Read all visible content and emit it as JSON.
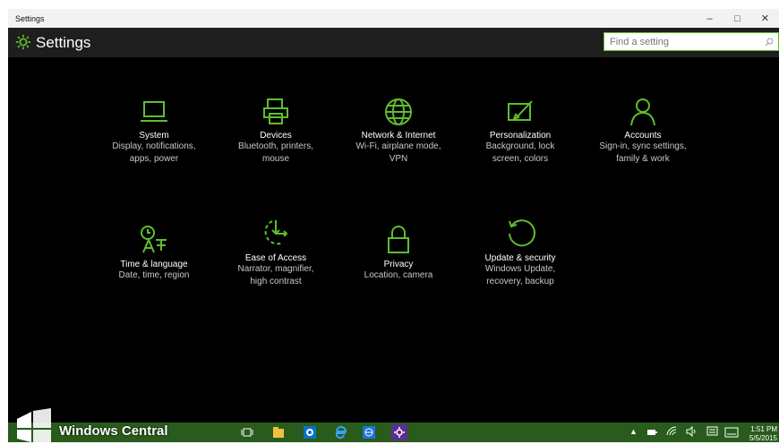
{
  "window": {
    "title": "Settings",
    "min": "–",
    "max": "□",
    "close": "✕"
  },
  "header": {
    "title": "Settings",
    "search_placeholder": "Find a setting"
  },
  "tiles": [
    {
      "title": "System",
      "desc1": "Display, notifications,",
      "desc2": "apps, power",
      "icon": "laptop-icon"
    },
    {
      "title": "Devices",
      "desc1": "Bluetooth, printers,",
      "desc2": "mouse",
      "icon": "printer-icon"
    },
    {
      "title": "Network & Internet",
      "desc1": "Wi-Fi, airplane mode,",
      "desc2": "VPN",
      "icon": "globe-icon"
    },
    {
      "title": "Personalization",
      "desc1": "Background, lock",
      "desc2": "screen, colors",
      "icon": "paintbrush-icon"
    },
    {
      "title": "Accounts",
      "desc1": "Sign-in, sync settings,",
      "desc2": "family & work",
      "icon": "person-icon"
    },
    {
      "title": "Time & language",
      "desc1": "Date, time, region",
      "desc2": "",
      "icon": "time-language-icon"
    },
    {
      "title": "Ease of Access",
      "desc1": "Narrator, magnifier,",
      "desc2": "high contrast",
      "icon": "ease-of-access-icon"
    },
    {
      "title": "Privacy",
      "desc1": "Location, camera",
      "desc2": "",
      "icon": "lock-icon"
    },
    {
      "title": "Update & security",
      "desc1": "Windows Update,",
      "desc2": "recovery, backup",
      "icon": "refresh-icon"
    }
  ],
  "taskbar": {
    "brand": "Windows Central",
    "time": "1:51 PM",
    "date": "5/5/2015"
  },
  "colors": {
    "accent": "#5fbd2e",
    "taskbar": "#285b1c",
    "header": "#1e1e1e"
  }
}
